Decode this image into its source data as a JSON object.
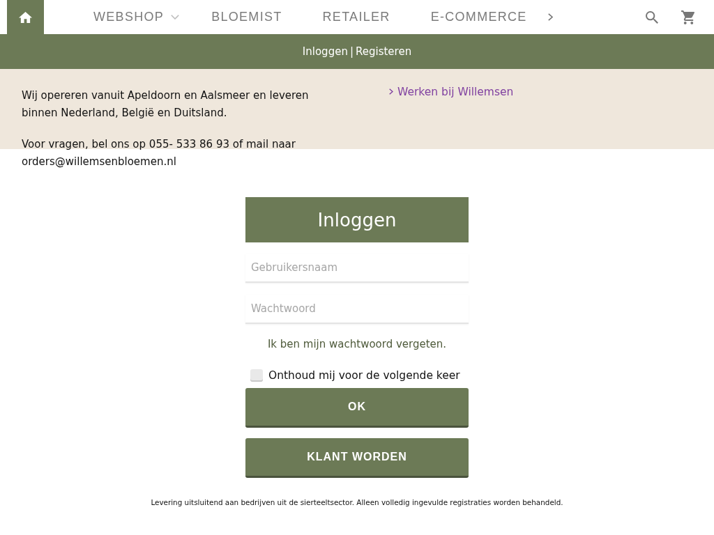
{
  "nav": {
    "items": [
      {
        "label": "WEBSHOP",
        "kind": "dropdown"
      },
      {
        "label": "BLOEMIST",
        "kind": "link"
      },
      {
        "label": "RETAILER",
        "kind": "link"
      },
      {
        "label": "E-COMMERCE",
        "kind": "link"
      }
    ]
  },
  "account_bar": {
    "links": [
      "Inloggen",
      "Registeren"
    ],
    "separator": "|"
  },
  "info": {
    "paragraphs": [
      "Wij opereren vanuit Apeldoorn en Aalsmeer en leveren binnen Nederland, België en Duitsland.",
      "Voor vragen, bel ons op 055- 533 86 93 of mail naar orders@willemsenbloemen.nl"
    ],
    "links": [
      "Werken bij Willemsen"
    ]
  },
  "login": {
    "title": "Inloggen",
    "fields": [
      {
        "placeholder": "Gebruikersnaam"
      },
      {
        "placeholder": "Wachtwoord"
      }
    ],
    "forgot_link": "Ik ben mijn wachtwoord vergeten.",
    "remember": {
      "label": "Onthoud mij voor de volgende keer",
      "checked": false
    },
    "buttons": [
      "OK",
      "KLANT WORDEN"
    ]
  },
  "footer_note": "Levering uitsluitend aan bedrijven uit de sierteeltsector. Alleen volledig ingevulde registraties worden behandeld."
}
